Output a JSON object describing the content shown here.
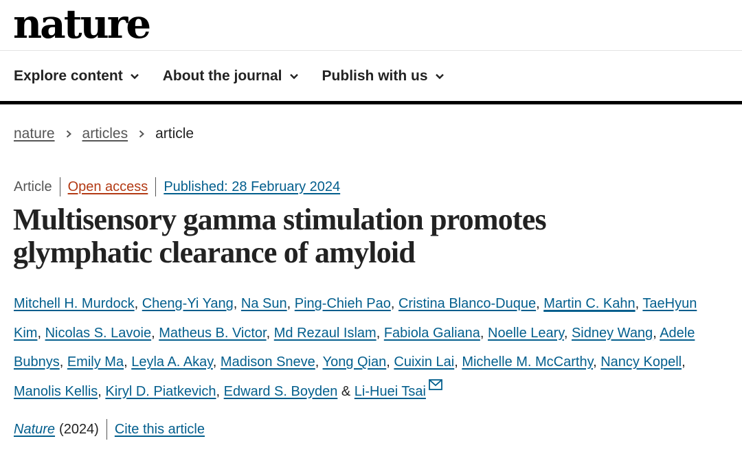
{
  "header": {
    "logo": "nature"
  },
  "nav": {
    "items": [
      {
        "label": "Explore content"
      },
      {
        "label": "About the journal"
      },
      {
        "label": "Publish with us"
      }
    ]
  },
  "breadcrumb": {
    "items": [
      "nature",
      "articles"
    ],
    "current": "article"
  },
  "article": {
    "type": "Article",
    "access": "Open access",
    "published": "Published: 28 February 2024",
    "title_line1": "Multisensory gamma stimulation promotes",
    "title_line2": "glymphatic clearance of amyloid",
    "authors": [
      "Mitchell H. Murdock",
      "Cheng-Yi Yang",
      "Na Sun",
      "Ping-Chieh Pao",
      "Cristina Blanco-Duque",
      "Martin C. Kahn",
      "TaeHyun Kim",
      "Nicolas S. Lavoie",
      "Matheus B. Victor",
      "Md Rezaul Islam",
      "Fabiola Galiana",
      "Noelle Leary",
      "Sidney Wang",
      "Adele Bubnys",
      "Emily Ma",
      "Leyla A. Akay",
      "Madison Sneve",
      "Yong Qian",
      "Cuixin Lai",
      "Michelle M. McCarthy",
      "Nancy Kopell",
      "Manolis Kellis",
      "Kiryl D. Piatkevich",
      "Edward S. Boyden",
      "Li-Huei Tsai"
    ],
    "author_separator": ", ",
    "author_last_separator": " & ",
    "contact_icon": "mail-icon",
    "journal": "Nature",
    "year": "(2024)",
    "cite_label": "Cite this article"
  },
  "colors": {
    "link": "#025e8d",
    "open_access": "#b33a14",
    "text": "#222222",
    "muted": "#555555"
  }
}
